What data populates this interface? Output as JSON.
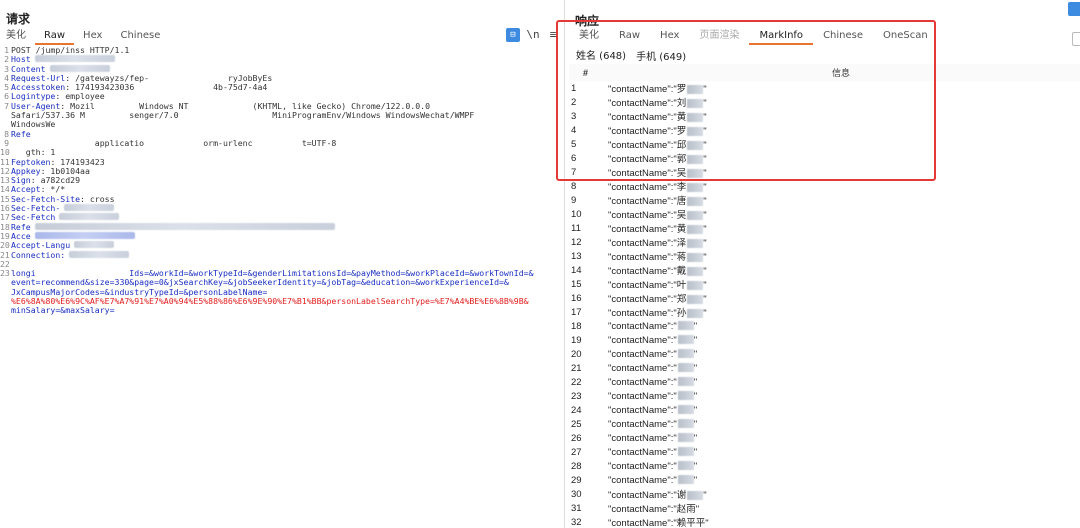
{
  "request": {
    "title": "请求",
    "tabs": [
      "美化",
      "Raw",
      "Hex",
      "Chinese"
    ],
    "active_tab": "Raw",
    "lines": [
      {
        "n": "1",
        "key": "",
        "text": "POST /jump/inss HTTP/1.1"
      },
      {
        "n": "2",
        "key": "Host",
        "text": ""
      },
      {
        "n": "3",
        "key": "Content",
        "text": ""
      },
      {
        "n": "4",
        "key": "Request-Url",
        "text": ": /gatewayzs/fep-                ryJobByEs"
      },
      {
        "n": "5",
        "key": "Accesstoken",
        "text": ": 174193423036                4b-75d7-4a4"
      },
      {
        "n": "6",
        "key": "Logintype",
        "text": ": employee"
      },
      {
        "n": "7",
        "key": "User-Agent",
        "text": ": Mozil         Windows NT             (KHTML, like Gecko) Chrome/122.0.0.0"
      },
      {
        "n": "",
        "key": "",
        "text": "Safari/537.36 M         senger/7.0                   MiniProgramEnv/Windows WindowsWechat/WMPF"
      },
      {
        "n": "",
        "key": "",
        "text": "WindowsWe"
      },
      {
        "n": "8",
        "key": "Refe",
        "text": ""
      },
      {
        "n": "9",
        "key": "",
        "text": "                 applicatio            orm-urlenc          t=UTF-8"
      },
      {
        "n": "10",
        "key": "",
        "text": "   gth: 1"
      },
      {
        "n": "11",
        "key": "Feptoken",
        "text": ": 174193423"
      },
      {
        "n": "12",
        "key": "Appkey",
        "text": ": 1b0104aa"
      },
      {
        "n": "13",
        "key": "Sign",
        "text": ": a782cd29"
      },
      {
        "n": "14",
        "key": "Accept",
        "text": ": */*"
      },
      {
        "n": "15",
        "key": "Sec-Fetch-Site",
        "text": ": cross"
      },
      {
        "n": "16",
        "key": "Sec-Fetch-",
        "text": ""
      },
      {
        "n": "17",
        "key": "Sec-Fetch",
        "text": ""
      },
      {
        "n": "18",
        "key": "Refe",
        "text": ""
      },
      {
        "n": "19",
        "key": "Acce",
        "text": ""
      },
      {
        "n": "20",
        "key": "Accept-Langu",
        "text": ""
      },
      {
        "n": "21",
        "key": "Connection",
        "text": ":"
      },
      {
        "n": "22",
        "key": "",
        "text": ""
      },
      {
        "n": "23",
        "key": "",
        "text": "longi                   Ids=&workId=&workTypeId=&genderLimitationsId=&payMethod=&workPlaceId=&workTownId=&"
      },
      {
        "n": "",
        "key": "",
        "text": "event=recommend&size=330&page=0&jxSearchKey=&jobSeekerIdentity=&jobTag=&education=&workExperienceId=&"
      },
      {
        "n": "",
        "key": "",
        "text": "JxCampusMajorCodes=&industryTypeId=&personLabelName="
      },
      {
        "n": "",
        "key": "",
        "text": "%E6%8A%80%E6%9C%AF%E7%A7%91%E7%A0%94%E5%88%86%E6%9E%90%E7%B1%BB&personLabelSearchType=%E7%A4%BE%E6%8B%9B&"
      },
      {
        "n": "",
        "key": "",
        "text": "minSalary=&maxSalary="
      }
    ]
  },
  "response": {
    "title": "响应",
    "tabs": [
      "美化",
      "Raw",
      "Hex",
      "页面渲染",
      "MarkInfo",
      "Chinese",
      "OneScan"
    ],
    "active_tab": "MarkInfo",
    "subtabs": [
      "姓名 (648)",
      "手机 (649)"
    ],
    "active_subtab": "姓名 (648)",
    "table": {
      "col_num": "#",
      "col_info": "信息",
      "rows": [
        {
          "n": "1",
          "v": "\"contactName\":\"罗"
        },
        {
          "n": "2",
          "v": "\"contactName\":\"刘"
        },
        {
          "n": "3",
          "v": "\"contactName\":\"黄"
        },
        {
          "n": "4",
          "v": "\"contactName\":\"罗"
        },
        {
          "n": "5",
          "v": "\"contactName\":\"邱"
        },
        {
          "n": "6",
          "v": "\"contactName\":\"郭"
        },
        {
          "n": "7",
          "v": "\"contactName\":\"吴"
        },
        {
          "n": "8",
          "v": "\"contactName\":\"李"
        },
        {
          "n": "9",
          "v": "\"contactName\":\"唐"
        },
        {
          "n": "10",
          "v": "\"contactName\":\"吴"
        },
        {
          "n": "11",
          "v": "\"contactName\":\"黄"
        },
        {
          "n": "12",
          "v": "\"contactName\":\"泽"
        },
        {
          "n": "13",
          "v": "\"contactName\":\"蒋"
        },
        {
          "n": "14",
          "v": "\"contactName\":\"戴"
        },
        {
          "n": "15",
          "v": "\"contactName\":\"叶"
        },
        {
          "n": "16",
          "v": "\"contactName\":\"郑"
        },
        {
          "n": "17",
          "v": "\"contactName\":\"孙"
        },
        {
          "n": "18",
          "v": "\"contactName\":\""
        },
        {
          "n": "19",
          "v": "\"contactName\":\""
        },
        {
          "n": "20",
          "v": "\"contactName\":\""
        },
        {
          "n": "21",
          "v": "\"contactName\":\""
        },
        {
          "n": "22",
          "v": "\"contactName\":\""
        },
        {
          "n": "23",
          "v": "\"contactName\":\""
        },
        {
          "n": "24",
          "v": "\"contactName\":\""
        },
        {
          "n": "25",
          "v": "\"contactName\":\""
        },
        {
          "n": "26",
          "v": "\"contactName\":\""
        },
        {
          "n": "27",
          "v": "\"contactName\":\""
        },
        {
          "n": "28",
          "v": "\"contactName\":\""
        },
        {
          "n": "29",
          "v": "\"contactName\":\""
        },
        {
          "n": "30",
          "v": "\"contactName\":\"谢"
        },
        {
          "n": "31",
          "v": "\"contactName\":\"赵雨\""
        },
        {
          "n": "32",
          "v": "\"contactName\":\"赖平平\""
        }
      ]
    }
  },
  "colors": {
    "accent": "#e8752f",
    "highlight_box": "#e53935",
    "key_blue": "#1a2ec0",
    "encoded_red": "#e02020"
  }
}
